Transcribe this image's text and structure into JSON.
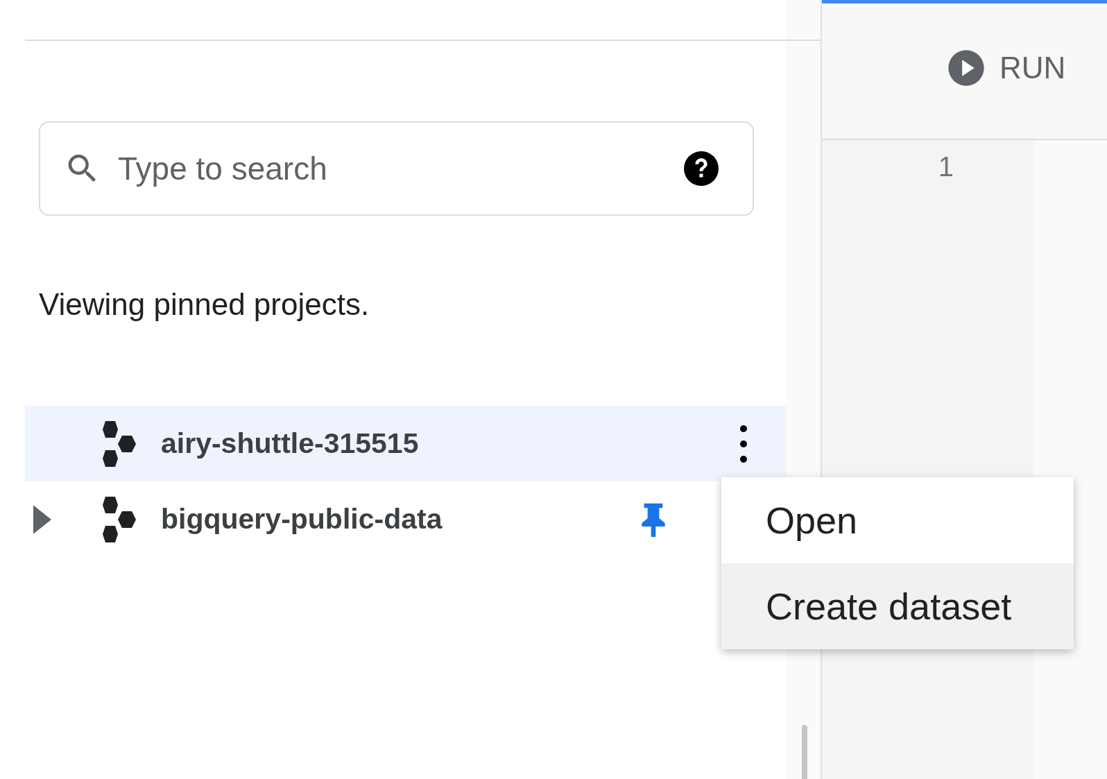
{
  "search": {
    "placeholder": "Type to search"
  },
  "notice": "Viewing pinned projects.",
  "projects": [
    {
      "name": "airy-shuttle-315515",
      "expandable": false,
      "selected": true,
      "pinned": false
    },
    {
      "name": "bigquery-public-data",
      "expandable": true,
      "selected": false,
      "pinned": true
    }
  ],
  "context_menu": [
    {
      "label": "Open",
      "selected": false
    },
    {
      "label": "Create dataset",
      "selected": true
    }
  ],
  "toolbar": {
    "run_label": "RUN"
  },
  "editor": {
    "line_numbers": [
      "1"
    ]
  }
}
